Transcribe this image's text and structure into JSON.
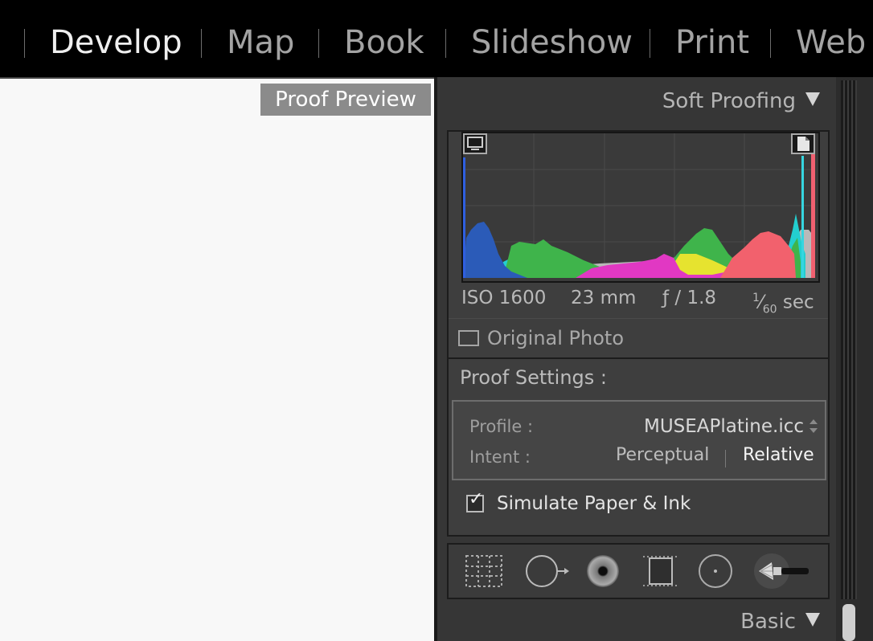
{
  "modules": [
    "Develop",
    "Map",
    "Book",
    "Slideshow",
    "Print",
    "Web"
  ],
  "active_module": "Develop",
  "canvas": {
    "proof_preview_label": "Proof Preview"
  },
  "panel": {
    "soft_proofing_title": "Soft Proofing",
    "exif": {
      "iso": "ISO 1600",
      "focal": "23 mm",
      "aperture": "ƒ / 1.8",
      "shutter_num": "1",
      "shutter_den": "60",
      "shutter_unit": "sec"
    },
    "original_photo_label": "Original Photo",
    "original_photo_checked": false,
    "proof_settings_label": "Proof Settings :",
    "profile_label": "Profile :",
    "profile_value": "MUSEAPlatine.icc",
    "intent_label": "Intent :",
    "intent_options": [
      "Perceptual",
      "Relative"
    ],
    "intent_selected": "Relative",
    "simulate_label": "Simulate Paper & Ink",
    "simulate_checked": true,
    "checkmark": "✓",
    "basic_title": "Basic"
  },
  "tools": [
    "crop-overlay-tool",
    "spot-removal-tool",
    "red-eye-tool",
    "graduated-filter-tool",
    "radial-filter-tool",
    "adjustment-brush-tool"
  ],
  "colors": {
    "accent_text": "#efefef",
    "panel_bg": "#363636",
    "canvas_bg": "#f8f8f8"
  }
}
